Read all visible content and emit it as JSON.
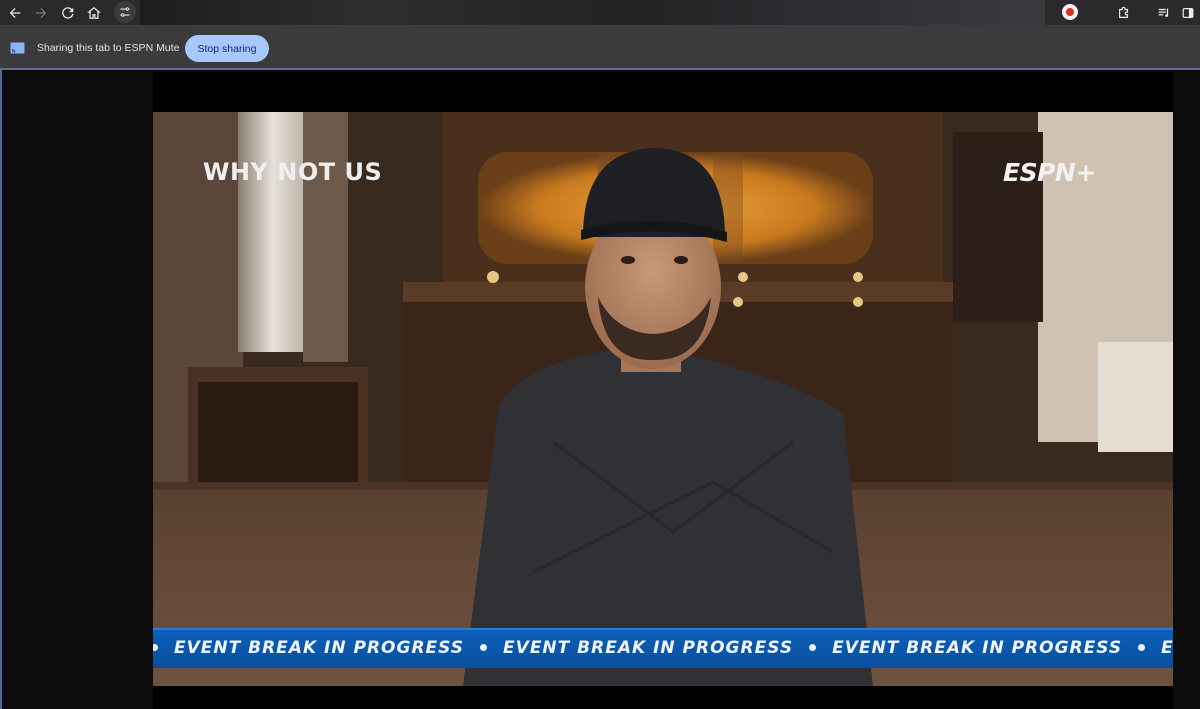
{
  "infobar": {
    "sharing_text": "Sharing this tab to ESPN Mute",
    "stop_label": "Stop sharing"
  },
  "video": {
    "show_title": "WHY NOT US",
    "network_logo": "ESPN+",
    "ticker_text": "EVENT BREAK IN PROGRESS",
    "ticker_repeat_visible": "EVENT B"
  },
  "icons": {
    "back": "arrow-left-icon",
    "forward": "arrow-right-icon",
    "reload": "reload-icon",
    "home": "home-icon",
    "site_info": "tune-icon",
    "record": "record-icon",
    "extensions": "puzzle-icon",
    "media": "queue-music-icon",
    "side_panel": "side-panel-icon",
    "cast": "cast-icon"
  },
  "colors": {
    "toolbar": "#2a2a2d",
    "infobar": "#3b3b3e",
    "stop_button": "#a8c7fa",
    "ticker": "#0a5bb0"
  }
}
